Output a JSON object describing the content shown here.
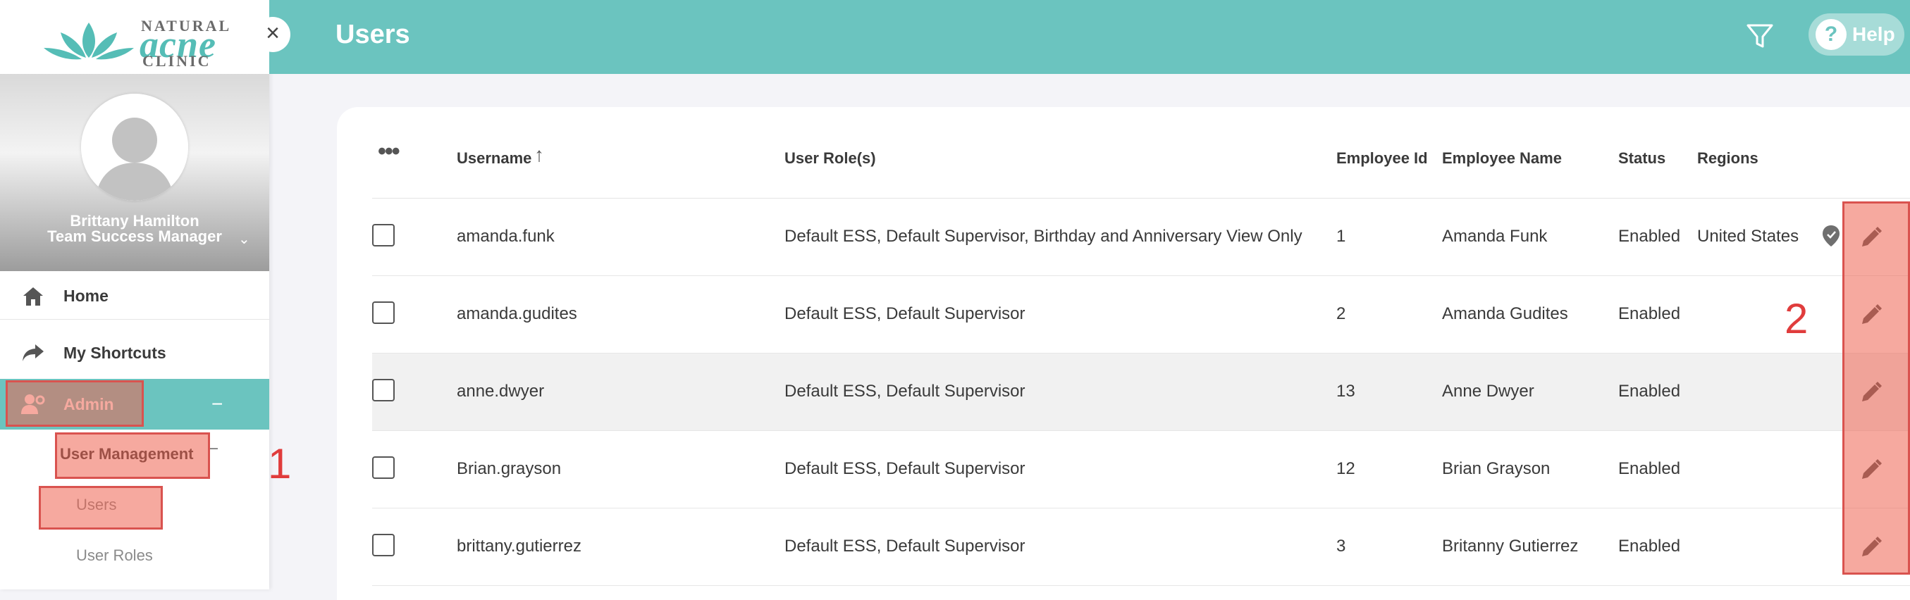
{
  "app": {
    "logo": {
      "line1": "NATURAL",
      "line2": "acne",
      "line3": "CLINIC"
    },
    "colors": {
      "brand": "#6bc4bf",
      "highlight": "#ee6250",
      "annotation": "#e03c3c"
    }
  },
  "sidebar": {
    "close_icon": "×",
    "profile": {
      "name": "Brittany Hamilton",
      "role": "Team Success Manager"
    },
    "nav": [
      {
        "label": "Home",
        "icon": "home-icon"
      },
      {
        "label": "My Shortcuts",
        "icon": "share-arrow-icon"
      },
      {
        "label": "Admin",
        "icon": "user-gear-icon",
        "expand": "−"
      }
    ],
    "admin_sub": {
      "user_management": "User Management",
      "user_management_collapse": "−",
      "users": "Users",
      "user_roles": "User Roles"
    }
  },
  "header": {
    "title": "Users",
    "help_icon": "?",
    "help_label": "Help"
  },
  "table": {
    "more_icon": "•••",
    "sort_icon": "↑",
    "columns": [
      "Username",
      "User Role(s)",
      "Employee Id",
      "Employee Name",
      "Status",
      "Regions"
    ],
    "rows": [
      {
        "username": "amanda.funk",
        "roles": "Default ESS, Default Supervisor, Birthday and Anniversary View Only",
        "employee_id": "1",
        "employee_name": "Amanda Funk",
        "status": "Enabled",
        "regions": "United States"
      },
      {
        "username": "amanda.gudites",
        "roles": "Default ESS, Default Supervisor",
        "employee_id": "2",
        "employee_name": "Amanda Gudites",
        "status": "Enabled",
        "regions": ""
      },
      {
        "username": "anne.dwyer",
        "roles": "Default ESS, Default Supervisor",
        "employee_id": "13",
        "employee_name": "Anne Dwyer",
        "status": "Enabled",
        "regions": ""
      },
      {
        "username": "Brian.grayson",
        "roles": "Default ESS, Default Supervisor",
        "employee_id": "12",
        "employee_name": "Brian Grayson",
        "status": "Enabled",
        "regions": ""
      },
      {
        "username": "brittany.gutierrez",
        "roles": "Default ESS, Default Supervisor",
        "employee_id": "3",
        "employee_name": "Britanny Gutierrez",
        "status": "Enabled",
        "regions": ""
      }
    ]
  },
  "annotations": {
    "step1": "1",
    "step2": "2"
  }
}
